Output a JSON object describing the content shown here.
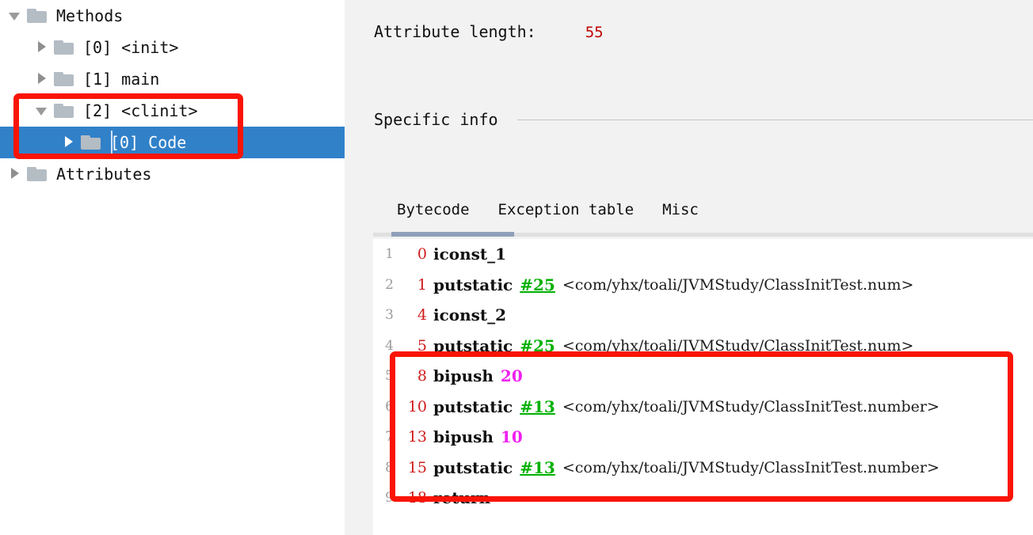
{
  "sidebar": {
    "tree": [
      {
        "label": "Methods",
        "depth": 0,
        "twisty": "down",
        "icon": "folder-icon",
        "selected": false
      },
      {
        "label": "[0] <init>",
        "depth": 1,
        "twisty": "right",
        "icon": "folder-icon",
        "selected": false
      },
      {
        "label": "[1] main",
        "depth": 1,
        "twisty": "right",
        "icon": "folder-icon",
        "selected": false
      },
      {
        "label": "[2] <clinit>",
        "depth": 1,
        "twisty": "down",
        "icon": "folder-icon",
        "selected": false
      },
      {
        "label": "[0] Code",
        "depth": 2,
        "twisty": "right",
        "icon": "folder-icon",
        "selected": true
      },
      {
        "label": "Attributes",
        "depth": 0,
        "twisty": "right",
        "icon": "folder-icon",
        "selected": false
      }
    ]
  },
  "main": {
    "attribute_length_label": "Attribute length:",
    "attribute_length_value": "55",
    "specific_info_title": "Specific info",
    "tabs": [
      {
        "label": "Bytecode",
        "active": true
      },
      {
        "label": "Exception table",
        "active": false
      },
      {
        "label": "Misc",
        "active": false
      }
    ],
    "bytecode": [
      {
        "line": "1",
        "offset": "0",
        "opcode": "iconst_1",
        "cpref": "",
        "imm": "",
        "descriptor": ""
      },
      {
        "line": "2",
        "offset": "1",
        "opcode": "putstatic",
        "cpref": "#25",
        "imm": "",
        "descriptor": "<com/yhx/toali/JVMStudy/ClassInitTest.num>"
      },
      {
        "line": "3",
        "offset": "4",
        "opcode": "iconst_2",
        "cpref": "",
        "imm": "",
        "descriptor": ""
      },
      {
        "line": "4",
        "offset": "5",
        "opcode": "putstatic",
        "cpref": "#25",
        "imm": "",
        "descriptor": "<com/yhx/toali/JVMStudy/ClassInitTest.num>"
      },
      {
        "line": "5",
        "offset": "8",
        "opcode": "bipush",
        "cpref": "",
        "imm": "20",
        "descriptor": ""
      },
      {
        "line": "6",
        "offset": "10",
        "opcode": "putstatic",
        "cpref": "#13",
        "imm": "",
        "descriptor": "<com/yhx/toali/JVMStudy/ClassInitTest.number>"
      },
      {
        "line": "7",
        "offset": "13",
        "opcode": "bipush",
        "cpref": "",
        "imm": "10",
        "descriptor": ""
      },
      {
        "line": "8",
        "offset": "15",
        "opcode": "putstatic",
        "cpref": "#13",
        "imm": "",
        "descriptor": "<com/yhx/toali/JVMStudy/ClassInitTest.number>"
      },
      {
        "line": "9",
        "offset": "18",
        "opcode": "return",
        "cpref": "",
        "imm": "",
        "descriptor": ""
      }
    ]
  },
  "annotations": [
    {
      "name": "sidebar-highlight",
      "color": "#fa1405"
    },
    {
      "name": "bytecode-highlight",
      "color": "#fa1405"
    }
  ],
  "colors": {
    "selection_blue": "#3181c9",
    "annotation_red": "#fa1405",
    "offset_red": "#d01c1c",
    "cpref_green": "#00b000",
    "immediate_magenta": "#f020f0",
    "value_red": "#c00000",
    "tab_underline": "#8fa0b8",
    "folder_gray": "#b4bcc4"
  }
}
